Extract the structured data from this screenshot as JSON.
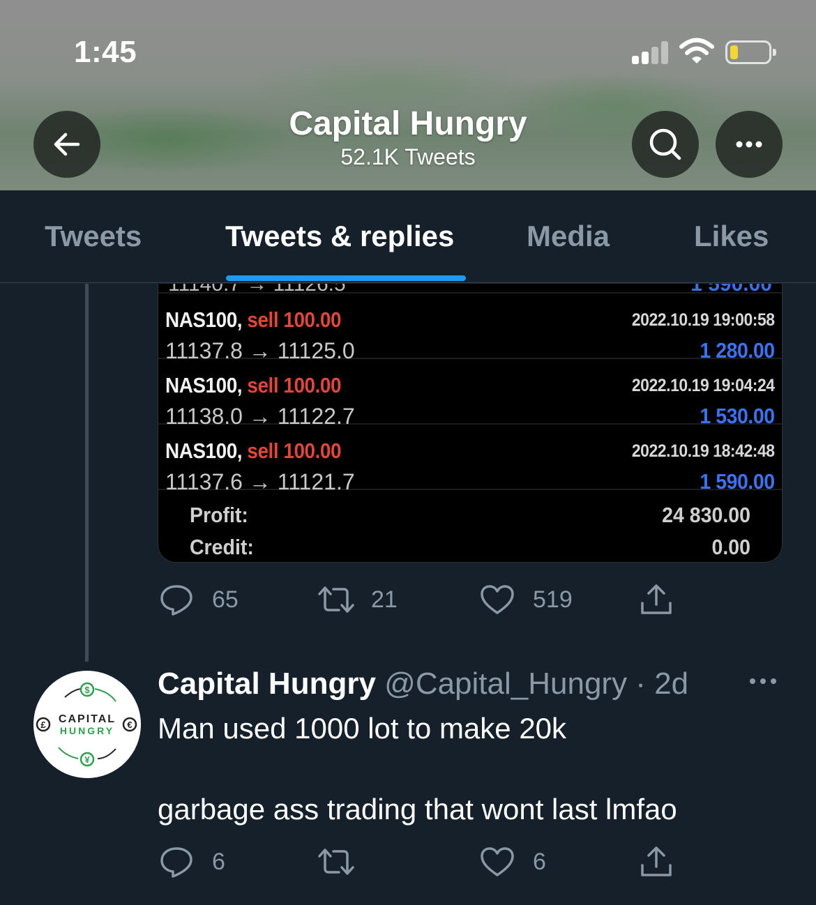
{
  "status_bar": {
    "time": "1:45",
    "battery_level": 0.2,
    "battery_color": "#f2d635"
  },
  "header": {
    "title": "Capital Hungry",
    "subtitle": "52.1K Tweets",
    "icons": [
      "back-arrow-icon",
      "search-icon",
      "more-icon"
    ]
  },
  "tabs": [
    {
      "label": "Tweets",
      "active": false
    },
    {
      "label": "Tweets & replies",
      "active": true
    },
    {
      "label": "Media",
      "active": false
    },
    {
      "label": "Likes",
      "active": false
    }
  ],
  "accent_color": "#1d9bf0",
  "trade_card": {
    "trades": [
      {
        "symbol": "NAS100,",
        "side": "sell 100.00",
        "date": "2022.10.19 19:00:58",
        "prices": "11137.8 → 11125.0",
        "profit": "1 280.00"
      },
      {
        "symbol": "NAS100,",
        "side": "sell 100.00",
        "date": "2022.10.19 19:04:24",
        "prices": "11138.0 → 11122.7",
        "profit": "1 530.00"
      },
      {
        "symbol": "NAS100,",
        "side": "sell 100.00",
        "date": "2022.10.19 18:42:48",
        "prices": "11137.6 → 11121.7",
        "profit": "1 590.00"
      }
    ],
    "summary": [
      {
        "label": "Profit:",
        "value": "24 830.00"
      },
      {
        "label": "Credit:",
        "value": "0.00"
      }
    ]
  },
  "tweet1_actions": {
    "replies": "65",
    "retweets": "21",
    "likes": "519"
  },
  "tweet2": {
    "name": "Capital Hungry",
    "handle_time": " @Capital_Hungry · 2d",
    "avatar_text_top": "CAPITAL",
    "avatar_text_bottom": "HUNGRY",
    "text_line1": "Man used 1000 lot to make 20k",
    "text_line2": "garbage ass trading that wont last lmfao",
    "actions": {
      "replies": "6",
      "retweets": "",
      "likes": "6"
    }
  }
}
